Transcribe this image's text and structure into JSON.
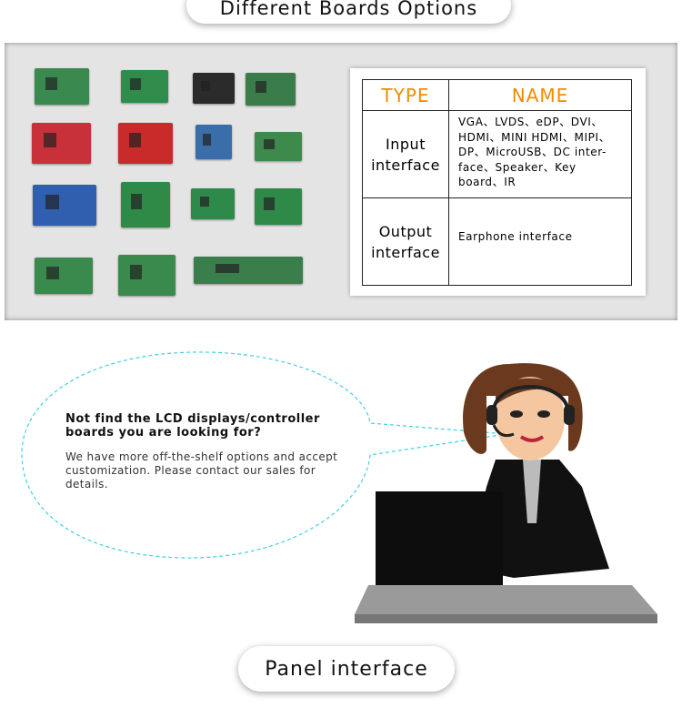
{
  "header": {
    "title": "Different Boards Options"
  },
  "boards": {
    "colors": [
      "#3a8a50",
      "#2f8c4a",
      "#2b2b2b",
      "#3b7d4a",
      "#c8303a",
      "#c92b2b",
      "#3a6ea8",
      "#3d8a4c",
      "#2f5fae",
      "#2f8a48",
      "#2e8a4a",
      "#2f8a4a",
      "#3a8a4e",
      "#3a8a4e",
      "#3a7e4c"
    ]
  },
  "table": {
    "headers": [
      "TYPE",
      "NAME"
    ],
    "rows": [
      {
        "type": "Input interface",
        "name": "VGA、LVDS、eDP、DVI、HDMI、MINI HDMI、MIPI、DP、MicroUSB、DC inter-face、Speaker、Key board、IR"
      },
      {
        "type": "Output interface",
        "name": "Earphone interface"
      }
    ],
    "header_color": "#f08c00"
  },
  "bubble": {
    "question": "Not find the LCD displays/controller boards you are looking for?",
    "answer": "We have more off-the-shelf options and accept customization. Please contact our sales for details.",
    "border_color": "#3fd0e0"
  },
  "footer": {
    "title": "Panel interface"
  }
}
